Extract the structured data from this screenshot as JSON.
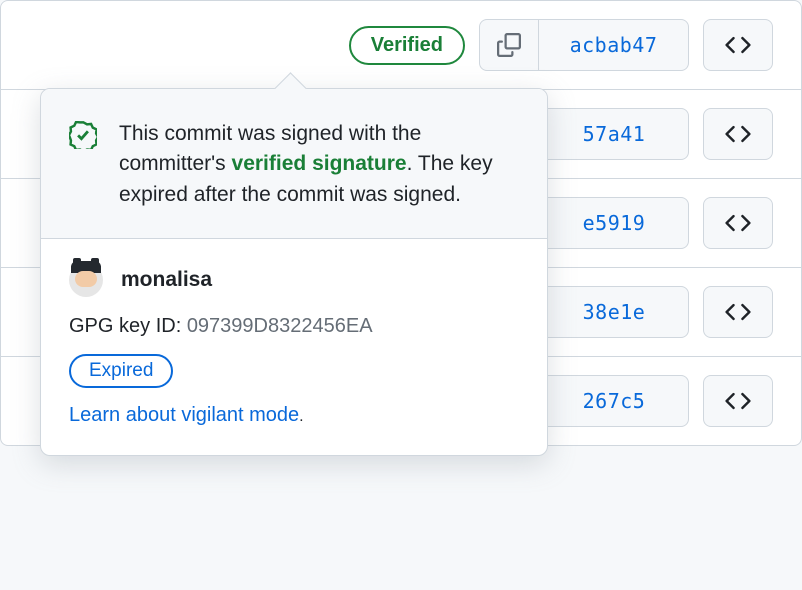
{
  "commits": [
    {
      "sha": "acbab47",
      "verified_label": "Verified"
    },
    {
      "sha": "57a41"
    },
    {
      "sha": "e5919"
    },
    {
      "sha": "38e1e"
    },
    {
      "sha": "267c5"
    }
  ],
  "popover": {
    "text_prefix": "This commit was signed with the committer's ",
    "link_text": "verified signature",
    "text_suffix": ". The key expired after the commit was signed.",
    "username": "monalisa",
    "gpg_label": "GPG key ID: ",
    "gpg_key_id": "097399D8322456EA",
    "expired_label": "Expired",
    "learn_text": "Learn about vigilant mode",
    "learn_suffix": "."
  }
}
